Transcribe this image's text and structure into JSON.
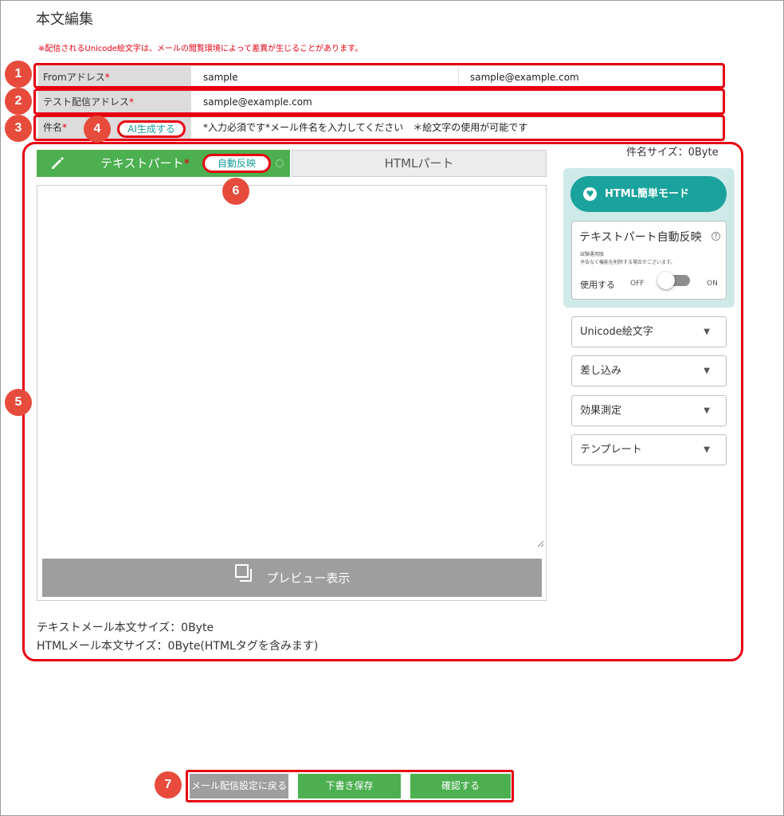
{
  "page": {
    "title": "本文編集",
    "notice": "※配信されるUnicode絵文字は、メールの閲覧環境によって差異が生じることがあります。"
  },
  "markers": [
    "1",
    "2",
    "3",
    "4",
    "5",
    "6",
    "7"
  ],
  "from_row": {
    "label": "Fromアドレス",
    "name_value": "sample",
    "email_value": "sample@example.com"
  },
  "test_row": {
    "label": "テスト配信アドレス",
    "value": "sample@example.com"
  },
  "subject_row": {
    "label": "件名",
    "ai_button": "AI生成する",
    "placeholder": "*入力必須です*メール件名を入力してください　＊絵文字の使用が可能です"
  },
  "required_mark": "*",
  "subject_size": "件名サイズ：0Byte",
  "tabs": {
    "text_part": "テキストパート",
    "auto_reflect": "自動反映",
    "html_part": "HTMLパート"
  },
  "preview_button": "プレビュー表示",
  "sizes": {
    "text_mail": "テキストメール本文サイズ：0Byte",
    "html_mail": "HTMLメール本文サイズ：0Byte(HTMLタグを含みます)"
  },
  "side": {
    "html_easy_mode": "HTML簡単モード",
    "auto_card_title": "テキストパート自動反映",
    "trial_label": "試験運用版",
    "trial_note": "予告なく機能を削除する場合がございます。",
    "use_label": "使用する",
    "off_label": "OFF",
    "on_label": "ON",
    "toggle_state": "off",
    "dropdowns": [
      "Unicode絵文字",
      "差し込み",
      "効果測定",
      "テンプレート"
    ]
  },
  "bottom": {
    "back_button": "メール配信設定に戻る",
    "draft_button": "下書き保存",
    "confirm_button": "確認する"
  },
  "colors": {
    "accent_red": "#e60012",
    "green": "#4caf50",
    "teal": "#1aa39c",
    "gray_button": "#9e9e9e"
  }
}
